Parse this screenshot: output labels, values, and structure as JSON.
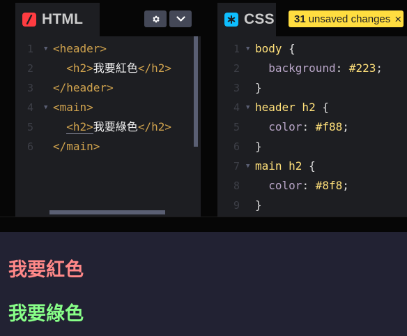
{
  "html_tab": {
    "title": "HTML",
    "badge_glyph": "/",
    "badge_color": "#ff3c41"
  },
  "css_tab": {
    "title": "CSS",
    "badge_glyph": "*",
    "badge_color": "#0ebeff"
  },
  "toolbar": {
    "settings_icon": "gear-icon",
    "collapse_icon": "chevron-down-icon"
  },
  "unsaved": {
    "count": "31",
    "label": "unsaved changes",
    "close": "×",
    "color": "#ffdd40"
  },
  "html_code": [
    {
      "n": "1",
      "fold": true,
      "parts": [
        [
          "c-tag",
          "<header>"
        ]
      ]
    },
    {
      "n": "2",
      "fold": false,
      "parts": [
        [
          "c-tag",
          "  <h2>"
        ],
        [
          "c-text",
          "我要紅色"
        ],
        [
          "c-tag",
          "</h2>"
        ]
      ]
    },
    {
      "n": "3",
      "fold": false,
      "parts": [
        [
          "c-tag",
          "</header>"
        ]
      ]
    },
    {
      "n": "4",
      "fold": true,
      "parts": [
        [
          "c-tag",
          "<main>"
        ]
      ]
    },
    {
      "n": "5",
      "fold": false,
      "parts": [
        [
          "c-tag",
          "  "
        ],
        [
          "c-tag underline",
          "<h2>"
        ],
        [
          "c-text",
          "我要綠色"
        ],
        [
          "c-tag",
          "</h2>"
        ]
      ]
    },
    {
      "n": "6",
      "fold": false,
      "parts": [
        [
          "c-tag",
          "</main>"
        ]
      ]
    }
  ],
  "css_code": [
    {
      "n": "1",
      "fold": true,
      "parts": [
        [
          "c-sel",
          "body "
        ],
        [
          "c-punc",
          "{"
        ]
      ]
    },
    {
      "n": "2",
      "fold": false,
      "parts": [
        [
          "c-prop",
          "  background"
        ],
        [
          "c-punc",
          ": "
        ],
        [
          "c-val",
          "#223"
        ],
        [
          "c-punc",
          ";"
        ]
      ]
    },
    {
      "n": "3",
      "fold": false,
      "parts": [
        [
          "c-punc",
          "}"
        ]
      ]
    },
    {
      "n": "4",
      "fold": true,
      "parts": [
        [
          "c-sel",
          "header h2 "
        ],
        [
          "c-punc",
          "{"
        ]
      ]
    },
    {
      "n": "5",
      "fold": false,
      "parts": [
        [
          "c-prop",
          "  color"
        ],
        [
          "c-punc",
          ": "
        ],
        [
          "c-val",
          "#f88"
        ],
        [
          "c-punc",
          ";"
        ]
      ]
    },
    {
      "n": "6",
      "fold": false,
      "parts": [
        [
          "c-punc",
          "}"
        ]
      ]
    },
    {
      "n": "7",
      "fold": true,
      "parts": [
        [
          "c-sel",
          "main h2 "
        ],
        [
          "c-punc",
          "{"
        ]
      ]
    },
    {
      "n": "8",
      "fold": false,
      "parts": [
        [
          "c-prop",
          "  color"
        ],
        [
          "c-punc",
          ": "
        ],
        [
          "c-val",
          "#8f8"
        ],
        [
          "c-punc",
          ";"
        ]
      ]
    },
    {
      "n": "9",
      "fold": false,
      "parts": [
        [
          "c-punc",
          "}"
        ]
      ]
    }
  ],
  "preview": {
    "background": "#222233",
    "heading_red": "我要紅色",
    "heading_red_color": "#ff8888",
    "heading_green": "我要綠色",
    "heading_green_color": "#88ff88"
  }
}
